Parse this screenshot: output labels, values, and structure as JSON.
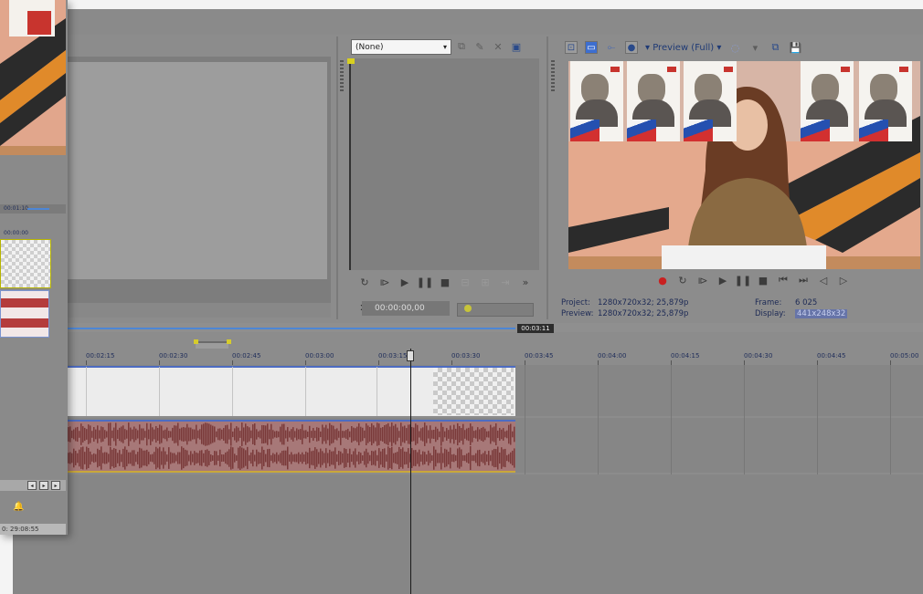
{
  "trimmer": {
    "source_select": "(None)",
    "timecode": "00:00:00,00"
  },
  "preview": {
    "quality_label": "Preview (Full)",
    "project_label": "Project:",
    "project_value": "1280x720x32; 25,879p",
    "preview_label": "Preview:",
    "preview_value": "1280x720x32; 25,879p",
    "frame_label": "Frame:",
    "frame_value": "6 025",
    "display_label": "Display:",
    "display_value": "441x248x32"
  },
  "timeline": {
    "badge": "00:03:11",
    "ruler": [
      {
        "label": "00:02:15"
      },
      {
        "label": "00:02:30"
      },
      {
        "label": "00:02:45"
      },
      {
        "label": "00:03:00"
      },
      {
        "label": "00:03:15"
      },
      {
        "label": "00:03:30"
      },
      {
        "label": "00:03:45"
      },
      {
        "label": "00:04:00"
      },
      {
        "label": "00:04:15"
      },
      {
        "label": "00:04:30"
      },
      {
        "label": "00:04:45"
      },
      {
        "label": "00:05:00"
      }
    ]
  },
  "left_window": {
    "bar_text": "00:01:10",
    "ruler_text": "00:00:00",
    "status": "0: 29:08:55"
  },
  "icons": {
    "trimmer_toolbar": [
      "clip-icon",
      "marker-icon",
      "cut-icon",
      "monitor-icon"
    ],
    "trimmer_transport": [
      "loop-icon",
      "play-from-start-icon",
      "play-icon",
      "pause-icon",
      "stop-icon",
      "prev-frame-icon",
      "next-frame-icon",
      "frame-step-icon",
      "more-icon"
    ],
    "preview_toolbar": [
      "properties-icon",
      "monitor-icon",
      "split-icon",
      "circle-icon",
      "overlays-icon",
      "copy-icon",
      "save-icon"
    ],
    "preview_transport": [
      "record-icon",
      "loop-icon",
      "play-from-start-icon",
      "play-icon",
      "pause-icon",
      "stop-icon",
      "go-start-icon",
      "go-end-icon",
      "prev-frame-icon",
      "next-frame-icon"
    ]
  }
}
